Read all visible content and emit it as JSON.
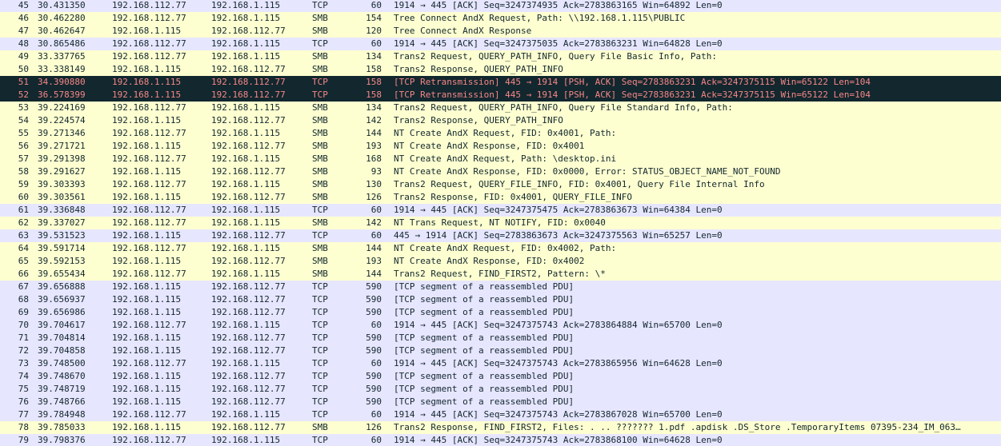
{
  "colors": {
    "tcp": "#e7e6ff",
    "smb": "#feffd0",
    "bad_bg": "#12272e",
    "bad_fg": "#f78787"
  },
  "packets": [
    {
      "no": "45",
      "time": "30.431350",
      "src": "192.168.112.77",
      "dst": "192.168.1.115",
      "proto": "TCP",
      "len": "60",
      "info": "1914 → 445 [ACK] Seq=3247374935 Ack=2783863165 Win=64892 Len=0",
      "style": "tcp"
    },
    {
      "no": "46",
      "time": "30.462280",
      "src": "192.168.112.77",
      "dst": "192.168.1.115",
      "proto": "SMB",
      "len": "154",
      "info": "Tree Connect AndX Request, Path: \\\\192.168.1.115\\PUBLIC",
      "style": "smb"
    },
    {
      "no": "47",
      "time": "30.462647",
      "src": "192.168.1.115",
      "dst": "192.168.112.77",
      "proto": "SMB",
      "len": "120",
      "info": "Tree Connect AndX Response",
      "style": "smb"
    },
    {
      "no": "48",
      "time": "30.865486",
      "src": "192.168.112.77",
      "dst": "192.168.1.115",
      "proto": "TCP",
      "len": "60",
      "info": "1914 → 445 [ACK] Seq=3247375035 Ack=2783863231 Win=64828 Len=0",
      "style": "tcp"
    },
    {
      "no": "49",
      "time": "33.337765",
      "src": "192.168.112.77",
      "dst": "192.168.1.115",
      "proto": "SMB",
      "len": "134",
      "info": "Trans2 Request, QUERY_PATH_INFO, Query File Basic Info, Path:",
      "style": "smb"
    },
    {
      "no": "50",
      "time": "33.338149",
      "src": "192.168.1.115",
      "dst": "192.168.112.77",
      "proto": "SMB",
      "len": "158",
      "info": "Trans2 Response, QUERY_PATH_INFO",
      "style": "smb"
    },
    {
      "no": "51",
      "time": "34.390880",
      "src": "192.168.1.115",
      "dst": "192.168.112.77",
      "proto": "TCP",
      "len": "158",
      "info": "[TCP Retransmission] 445 → 1914 [PSH, ACK] Seq=2783863231 Ack=3247375115 Win=65122 Len=104",
      "style": "bad"
    },
    {
      "no": "52",
      "time": "36.578399",
      "src": "192.168.1.115",
      "dst": "192.168.112.77",
      "proto": "TCP",
      "len": "158",
      "info": "[TCP Retransmission] 445 → 1914 [PSH, ACK] Seq=2783863231 Ack=3247375115 Win=65122 Len=104",
      "style": "bad"
    },
    {
      "no": "53",
      "time": "39.224169",
      "src": "192.168.112.77",
      "dst": "192.168.1.115",
      "proto": "SMB",
      "len": "134",
      "info": "Trans2 Request, QUERY_PATH_INFO, Query File Standard Info, Path:",
      "style": "smb"
    },
    {
      "no": "54",
      "time": "39.224574",
      "src": "192.168.1.115",
      "dst": "192.168.112.77",
      "proto": "SMB",
      "len": "142",
      "info": "Trans2 Response, QUERY_PATH_INFO",
      "style": "smb"
    },
    {
      "no": "55",
      "time": "39.271346",
      "src": "192.168.112.77",
      "dst": "192.168.1.115",
      "proto": "SMB",
      "len": "144",
      "info": "NT Create AndX Request, FID: 0x4001, Path:",
      "style": "smb"
    },
    {
      "no": "56",
      "time": "39.271721",
      "src": "192.168.1.115",
      "dst": "192.168.112.77",
      "proto": "SMB",
      "len": "193",
      "info": "NT Create AndX Response, FID: 0x4001",
      "style": "smb"
    },
    {
      "no": "57",
      "time": "39.291398",
      "src": "192.168.112.77",
      "dst": "192.168.1.115",
      "proto": "SMB",
      "len": "168",
      "info": "NT Create AndX Request, Path: \\desktop.ini",
      "style": "smb"
    },
    {
      "no": "58",
      "time": "39.291627",
      "src": "192.168.1.115",
      "dst": "192.168.112.77",
      "proto": "SMB",
      "len": "93",
      "info": "NT Create AndX Response, FID: 0x0000, Error: STATUS_OBJECT_NAME_NOT_FOUND",
      "style": "smb"
    },
    {
      "no": "59",
      "time": "39.303393",
      "src": "192.168.112.77",
      "dst": "192.168.1.115",
      "proto": "SMB",
      "len": "130",
      "info": "Trans2 Request, QUERY_FILE_INFO, FID: 0x4001, Query File Internal Info",
      "style": "smb"
    },
    {
      "no": "60",
      "time": "39.303561",
      "src": "192.168.1.115",
      "dst": "192.168.112.77",
      "proto": "SMB",
      "len": "126",
      "info": "Trans2 Response, FID: 0x4001, QUERY_FILE_INFO",
      "style": "smb"
    },
    {
      "no": "61",
      "time": "39.336848",
      "src": "192.168.112.77",
      "dst": "192.168.1.115",
      "proto": "TCP",
      "len": "60",
      "info": "1914 → 445 [ACK] Seq=3247375475 Ack=2783863673 Win=64384 Len=0",
      "style": "tcp"
    },
    {
      "no": "62",
      "time": "39.337027",
      "src": "192.168.112.77",
      "dst": "192.168.1.115",
      "proto": "SMB",
      "len": "142",
      "info": "NT Trans Request, NT NOTIFY, FID: 0x0040",
      "style": "smb"
    },
    {
      "no": "63",
      "time": "39.531523",
      "src": "192.168.1.115",
      "dst": "192.168.112.77",
      "proto": "TCP",
      "len": "60",
      "info": "445 → 1914 [ACK] Seq=2783863673 Ack=3247375563 Win=65257 Len=0",
      "style": "tcp"
    },
    {
      "no": "64",
      "time": "39.591714",
      "src": "192.168.112.77",
      "dst": "192.168.1.115",
      "proto": "SMB",
      "len": "144",
      "info": "NT Create AndX Request, FID: 0x4002, Path:",
      "style": "smb"
    },
    {
      "no": "65",
      "time": "39.592153",
      "src": "192.168.1.115",
      "dst": "192.168.112.77",
      "proto": "SMB",
      "len": "193",
      "info": "NT Create AndX Response, FID: 0x4002",
      "style": "smb"
    },
    {
      "no": "66",
      "time": "39.655434",
      "src": "192.168.112.77",
      "dst": "192.168.1.115",
      "proto": "SMB",
      "len": "144",
      "info": "Trans2 Request, FIND_FIRST2, Pattern: \\*",
      "style": "smb"
    },
    {
      "no": "67",
      "time": "39.656888",
      "src": "192.168.1.115",
      "dst": "192.168.112.77",
      "proto": "TCP",
      "len": "590",
      "info": "[TCP segment of a reassembled PDU]",
      "style": "tcp"
    },
    {
      "no": "68",
      "time": "39.656937",
      "src": "192.168.1.115",
      "dst": "192.168.112.77",
      "proto": "TCP",
      "len": "590",
      "info": "[TCP segment of a reassembled PDU]",
      "style": "tcp"
    },
    {
      "no": "69",
      "time": "39.656986",
      "src": "192.168.1.115",
      "dst": "192.168.112.77",
      "proto": "TCP",
      "len": "590",
      "info": "[TCP segment of a reassembled PDU]",
      "style": "tcp"
    },
    {
      "no": "70",
      "time": "39.704617",
      "src": "192.168.112.77",
      "dst": "192.168.1.115",
      "proto": "TCP",
      "len": "60",
      "info": "1914 → 445 [ACK] Seq=3247375743 Ack=2783864884 Win=65700 Len=0",
      "style": "tcp"
    },
    {
      "no": "71",
      "time": "39.704814",
      "src": "192.168.1.115",
      "dst": "192.168.112.77",
      "proto": "TCP",
      "len": "590",
      "info": "[TCP segment of a reassembled PDU]",
      "style": "tcp"
    },
    {
      "no": "72",
      "time": "39.704858",
      "src": "192.168.1.115",
      "dst": "192.168.112.77",
      "proto": "TCP",
      "len": "590",
      "info": "[TCP segment of a reassembled PDU]",
      "style": "tcp"
    },
    {
      "no": "73",
      "time": "39.748500",
      "src": "192.168.112.77",
      "dst": "192.168.1.115",
      "proto": "TCP",
      "len": "60",
      "info": "1914 → 445 [ACK] Seq=3247375743 Ack=2783865956 Win=64628 Len=0",
      "style": "tcp"
    },
    {
      "no": "74",
      "time": "39.748670",
      "src": "192.168.1.115",
      "dst": "192.168.112.77",
      "proto": "TCP",
      "len": "590",
      "info": "[TCP segment of a reassembled PDU]",
      "style": "tcp"
    },
    {
      "no": "75",
      "time": "39.748719",
      "src": "192.168.1.115",
      "dst": "192.168.112.77",
      "proto": "TCP",
      "len": "590",
      "info": "[TCP segment of a reassembled PDU]",
      "style": "tcp"
    },
    {
      "no": "76",
      "time": "39.748766",
      "src": "192.168.1.115",
      "dst": "192.168.112.77",
      "proto": "TCP",
      "len": "590",
      "info": "[TCP segment of a reassembled PDU]",
      "style": "tcp"
    },
    {
      "no": "77",
      "time": "39.784948",
      "src": "192.168.112.77",
      "dst": "192.168.1.115",
      "proto": "TCP",
      "len": "60",
      "info": "1914 → 445 [ACK] Seq=3247375743 Ack=2783867028 Win=65700 Len=0",
      "style": "tcp"
    },
    {
      "no": "78",
      "time": "39.785033",
      "src": "192.168.1.115",
      "dst": "192.168.112.77",
      "proto": "SMB",
      "len": "126",
      "info": "Trans2 Response, FIND_FIRST2, Files: .  ..  ??????? 1.pdf .apdisk .DS_Store .TemporaryItems 07395-234_IM_063…",
      "style": "smb"
    },
    {
      "no": "79",
      "time": "39.798376",
      "src": "192.168.112.77",
      "dst": "192.168.1.115",
      "proto": "TCP",
      "len": "60",
      "info": "1914 → 445 [ACK] Seq=3247375743 Ack=2783868100 Win=64628 Len=0",
      "style": "tcp"
    }
  ]
}
